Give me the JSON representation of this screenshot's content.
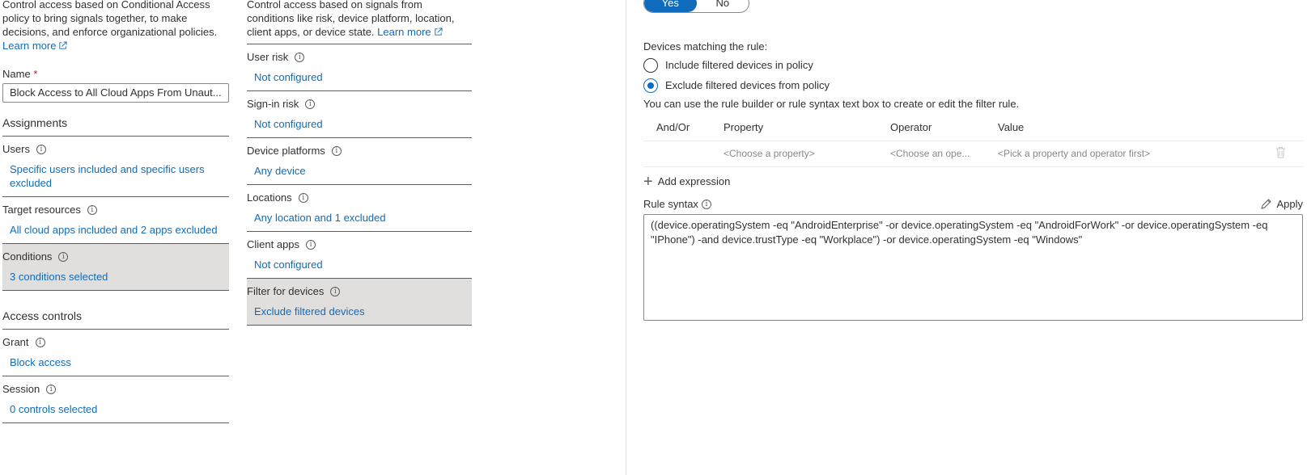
{
  "assignments_panel": {
    "intro": "Control access based on Conditional Access policy to bring signals together, to make decisions, and enforce organizational policies.",
    "learn_more": "Learn more",
    "name_label": "Name",
    "name_required": "*",
    "name_value": "Block Access to All Cloud Apps From Unaut...",
    "assignments_heading": "Assignments",
    "rows": [
      {
        "title": "Users",
        "value": "Specific users included and specific users excluded"
      },
      {
        "title": "Target resources",
        "value": "All cloud apps included and 2 apps excluded"
      },
      {
        "title": "Conditions",
        "value": "3 conditions selected"
      }
    ],
    "access_controls_heading": "Access controls",
    "controls": [
      {
        "title": "Grant",
        "value": "Block access"
      },
      {
        "title": "Session",
        "value": "0 controls selected"
      }
    ]
  },
  "conditions_panel": {
    "intro": "Control access based on signals from conditions like risk, device platform, location, client apps, or device state.",
    "learn_more": "Learn more",
    "rows": [
      {
        "title": "User risk",
        "value": "Not configured"
      },
      {
        "title": "Sign-in risk",
        "value": "Not configured"
      },
      {
        "title": "Device platforms",
        "value": "Any device"
      },
      {
        "title": "Locations",
        "value": "Any location and 1 excluded"
      },
      {
        "title": "Client apps",
        "value": "Not configured"
      },
      {
        "title": "Filter for devices",
        "value": "Exclude filtered devices"
      }
    ]
  },
  "filter_panel": {
    "toggle_yes": "Yes",
    "toggle_no": "No",
    "devices_matching_label": "Devices matching the rule:",
    "radio_include": "Include filtered devices in policy",
    "radio_exclude": "Exclude filtered devices from policy",
    "builder_hint": "You can use the rule builder or rule syntax text box to create or edit the filter rule.",
    "columns": {
      "andor": "And/Or",
      "property": "Property",
      "operator": "Operator",
      "value": "Value"
    },
    "row_placeholders": {
      "property": "<Choose a property>",
      "operator": "<Choose an ope...",
      "value": "<Pick a property and operator first>"
    },
    "add_expression": "Add expression",
    "rule_syntax_label": "Rule syntax",
    "apply_label": "Apply",
    "rule_syntax_value": "((device.operatingSystem -eq \"AndroidEnterprise\" -or device.operatingSystem -eq \"AndroidForWork\" -or device.operatingSystem -eq \"IPhone\") -and device.trustType -eq \"Workplace\") -or device.operatingSystem -eq \"Windows\""
  },
  "colors": {
    "accent": "#0f6cbd",
    "selected_row": "#e1dfdd",
    "required": "#a4262c"
  }
}
